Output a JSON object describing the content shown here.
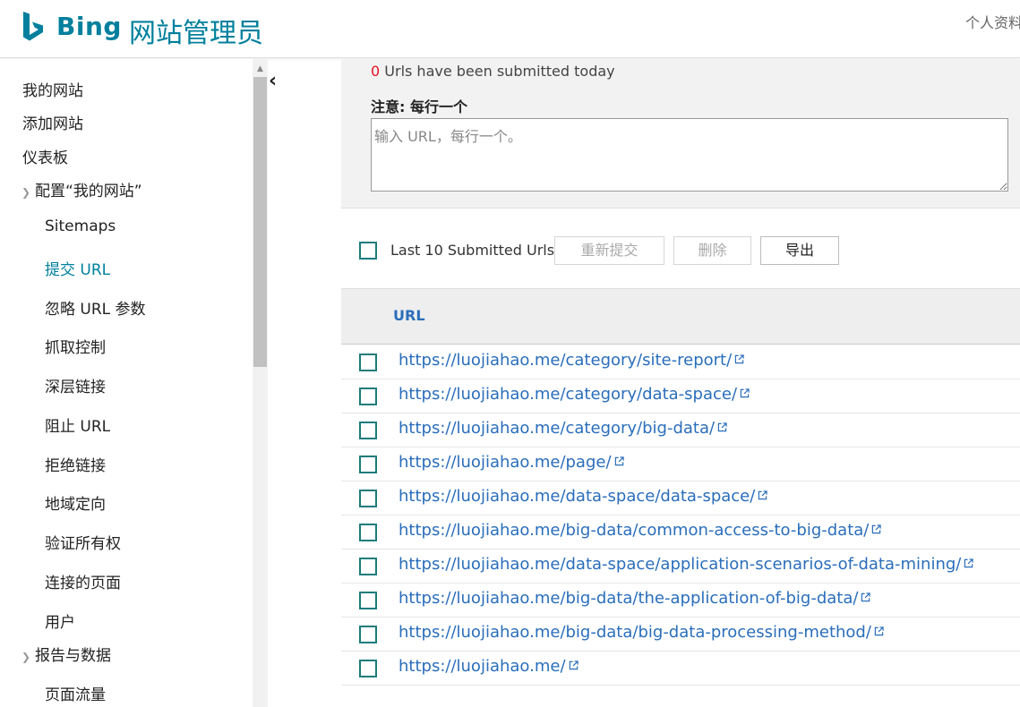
{
  "header": {
    "brand": "Bing",
    "product": "网站管理员",
    "profile": "个人资料"
  },
  "sidebar": {
    "items": [
      {
        "label": "我的网站",
        "level": 0
      },
      {
        "label": "添加网站",
        "level": 0
      },
      {
        "label": "仪表板",
        "level": 0
      },
      {
        "label": "配置“我的网站”",
        "level": 0,
        "expandable": true
      },
      {
        "label": "Sitemaps",
        "level": 1
      },
      {
        "label": "提交 URL",
        "level": 1,
        "active": true
      },
      {
        "label": "忽略 URL 参数",
        "level": 1
      },
      {
        "label": "抓取控制",
        "level": 1
      },
      {
        "label": "深层链接",
        "level": 1
      },
      {
        "label": "阻止 URL",
        "level": 1
      },
      {
        "label": "拒绝链接",
        "level": 1
      },
      {
        "label": "地域定向",
        "level": 1
      },
      {
        "label": "验证所有权",
        "level": 1
      },
      {
        "label": "连接的页面",
        "level": 1
      },
      {
        "label": "用户",
        "level": 1
      },
      {
        "label": "报告与数据",
        "level": 0,
        "expandable": true
      },
      {
        "label": "页面流量",
        "level": 1
      }
    ]
  },
  "form": {
    "submitted_count": "0",
    "submitted_text": " Urls have been submitted today",
    "note": "注意: 每行一个",
    "textarea_placeholder": "输入 URL，每行一个。"
  },
  "toolbar": {
    "label": "Last 10 Submitted Urls",
    "resubmit": "重新提交",
    "delete": "删除",
    "export": "导出"
  },
  "table": {
    "column": "URL",
    "rows": [
      "https://luojiahao.me/category/site-report/",
      "https://luojiahao.me/category/data-space/",
      "https://luojiahao.me/category/big-data/",
      "https://luojiahao.me/page/",
      "https://luojiahao.me/data-space/data-space/",
      "https://luojiahao.me/big-data/common-access-to-big-data/",
      "https://luojiahao.me/data-space/application-scenarios-of-data-mining/",
      "https://luojiahao.me/big-data/the-application-of-big-data/",
      "https://luojiahao.me/big-data/big-data-processing-method/",
      "https://luojiahao.me/"
    ]
  },
  "colors": {
    "brand": "#00809d",
    "link": "#2a6ebb",
    "checkbox": "#1a7c7c",
    "count": "#e81123"
  }
}
